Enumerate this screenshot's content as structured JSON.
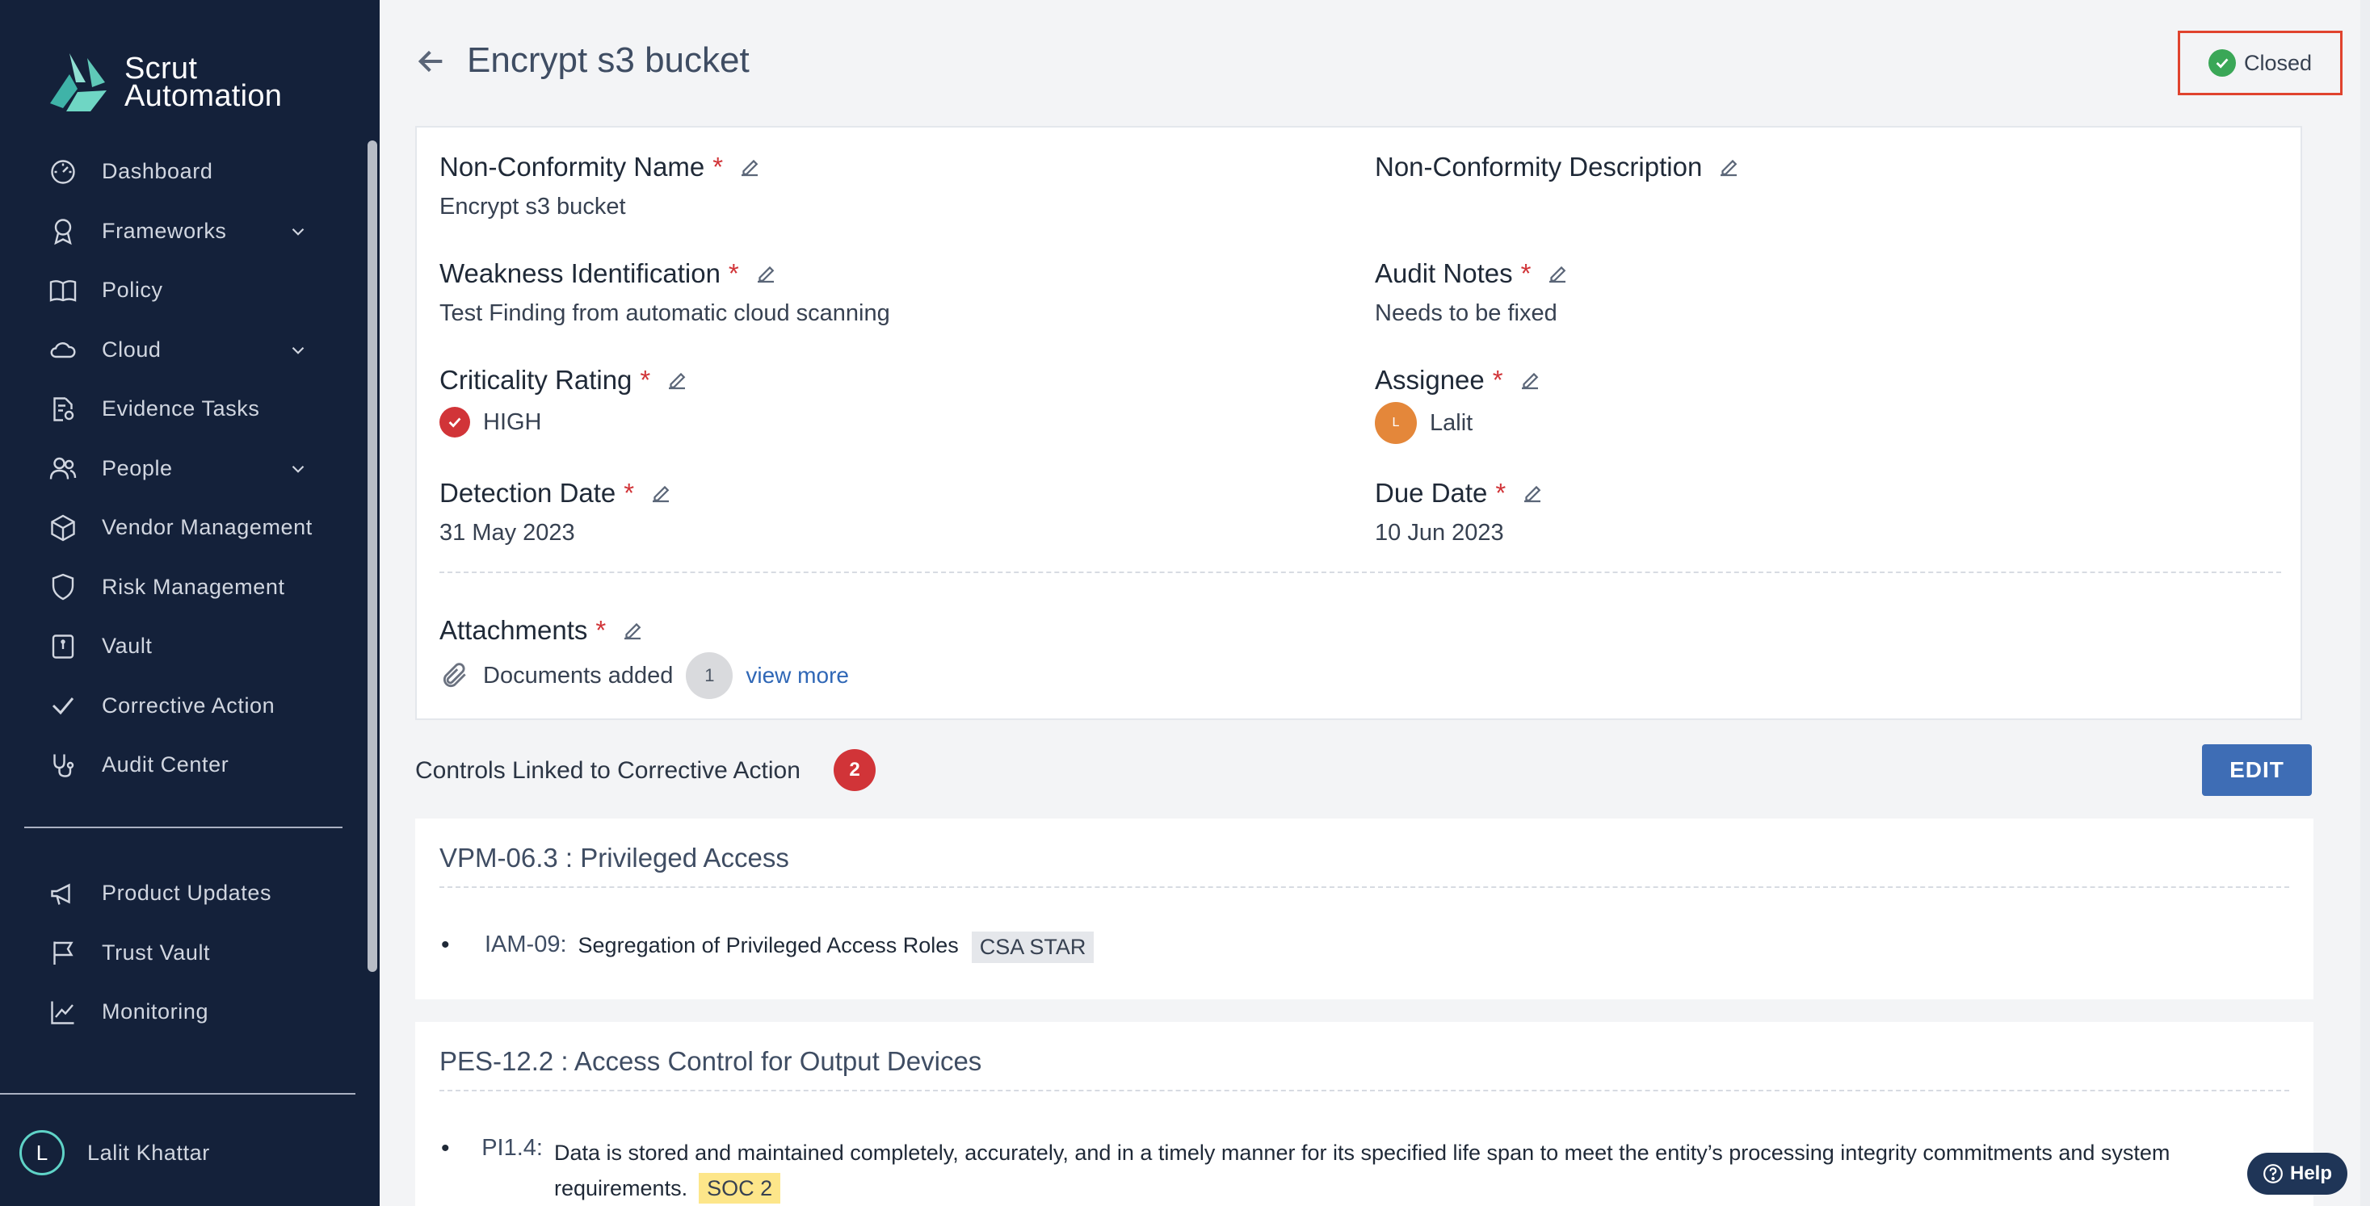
{
  "app": {
    "brand_line1": "Scrut",
    "brand_line2": "Automation"
  },
  "sidebar": {
    "items": [
      {
        "label": "Dashboard",
        "icon": "dashboard-icon",
        "has_chevron": false
      },
      {
        "label": "Frameworks",
        "icon": "award-icon",
        "has_chevron": true
      },
      {
        "label": "Policy",
        "icon": "book-icon",
        "has_chevron": false
      },
      {
        "label": "Cloud",
        "icon": "cloud-icon",
        "has_chevron": true
      },
      {
        "label": "Evidence Tasks",
        "icon": "evidence-icon",
        "has_chevron": false
      },
      {
        "label": "People",
        "icon": "people-icon",
        "has_chevron": true
      },
      {
        "label": "Vendor Management",
        "icon": "box-icon",
        "has_chevron": false
      },
      {
        "label": "Risk Management",
        "icon": "shield-icon",
        "has_chevron": false
      },
      {
        "label": "Vault",
        "icon": "vault-icon",
        "has_chevron": false
      },
      {
        "label": "Corrective Action",
        "icon": "check-icon",
        "has_chevron": false
      },
      {
        "label": "Audit Center",
        "icon": "stethoscope-icon",
        "has_chevron": false
      }
    ],
    "secondary": [
      {
        "label": "Product Updates",
        "icon": "megaphone-icon"
      },
      {
        "label": "Trust Vault",
        "icon": "flag-icon"
      },
      {
        "label": "Monitoring",
        "icon": "chart-icon"
      }
    ],
    "user": {
      "initial": "L",
      "name": "Lalit Khattar"
    }
  },
  "header": {
    "title": "Encrypt s3 bucket",
    "status": "Closed"
  },
  "details": {
    "nc_name": {
      "label": "Non-Conformity Name",
      "value": "Encrypt s3 bucket"
    },
    "nc_desc": {
      "label": "Non-Conformity Description",
      "value": ""
    },
    "weakness": {
      "label": "Weakness Identification",
      "value": "Test Finding from automatic cloud scanning"
    },
    "audit_notes": {
      "label": "Audit Notes",
      "value": "Needs to be fixed"
    },
    "criticality": {
      "label": "Criticality Rating",
      "value": "HIGH"
    },
    "assignee": {
      "label": "Assignee",
      "initial": "L",
      "value": "Lalit"
    },
    "detection_date": {
      "label": "Detection Date",
      "value": "31 May 2023"
    },
    "due_date": {
      "label": "Due Date",
      "value": "10 Jun 2023"
    },
    "attachments": {
      "label": "Attachments",
      "text": "Documents added",
      "count": "1",
      "link": "view more"
    },
    "required_mark": "*"
  },
  "linked": {
    "title": "Controls Linked to Corrective Action",
    "count": "2",
    "edit_label": "EDIT"
  },
  "controls": [
    {
      "heading": "VPM-06.3 :  Privileged Access",
      "items": [
        {
          "id": "IAM-09:",
          "desc": "Segregation of Privileged Access Roles",
          "tag": "CSA STAR"
        }
      ]
    },
    {
      "heading": "PES-12.2 :  Access Control for Output Devices",
      "items": [
        {
          "id": "PI1.4:",
          "desc": "Data is stored and maintained completely, accurately, and in a timely manner for its specified life span to meet the entity’s processing integrity commitments and system requirements.",
          "tag": "SOC 2"
        }
      ]
    }
  ],
  "help": {
    "label": "Help"
  },
  "colors": {
    "sidebar_bg": "#14213a",
    "accent": "#3e6db5",
    "required": "#d13438",
    "status_ok": "#3aa757"
  }
}
